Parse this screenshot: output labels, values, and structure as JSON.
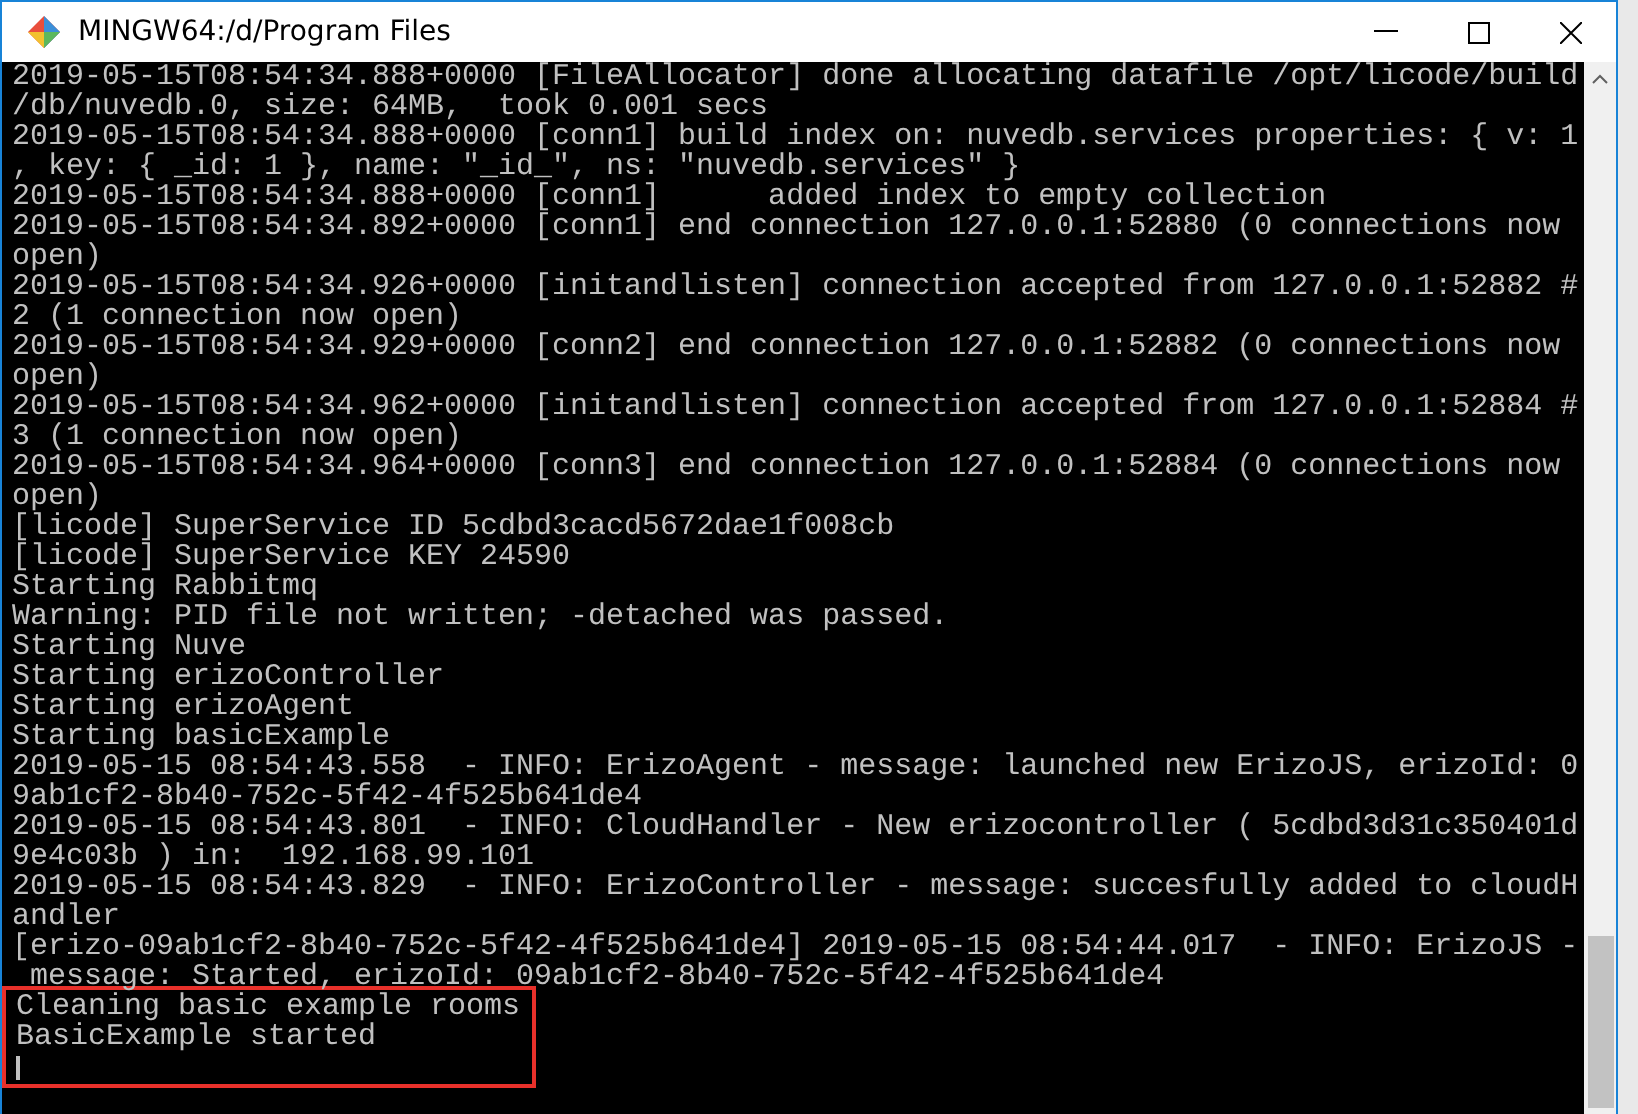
{
  "window": {
    "title": "MINGW64:/d/Program Files"
  },
  "terminal": {
    "lines": [
      "2019-05-15T08:54:34.888+0000 [FileAllocator] done allocating datafile /opt/licode/build",
      "/db/nuvedb.0, size: 64MB,  took 0.001 secs",
      "2019-05-15T08:54:34.888+0000 [conn1] build index on: nuvedb.services properties: { v: 1",
      ", key: { _id: 1 }, name: \"_id_\", ns: \"nuvedb.services\" }",
      "2019-05-15T08:54:34.888+0000 [conn1]      added index to empty collection",
      "2019-05-15T08:54:34.892+0000 [conn1] end connection 127.0.0.1:52880 (0 connections now",
      "open)",
      "2019-05-15T08:54:34.926+0000 [initandlisten] connection accepted from 127.0.0.1:52882 #",
      "2 (1 connection now open)",
      "2019-05-15T08:54:34.929+0000 [conn2] end connection 127.0.0.1:52882 (0 connections now",
      "open)",
      "2019-05-15T08:54:34.962+0000 [initandlisten] connection accepted from 127.0.0.1:52884 #",
      "3 (1 connection now open)",
      "2019-05-15T08:54:34.964+0000 [conn3] end connection 127.0.0.1:52884 (0 connections now",
      "open)",
      "[licode] SuperService ID 5cdbd3cacd5672dae1f008cb",
      "[licode] SuperService KEY 24590",
      "Starting Rabbitmq",
      "Warning: PID file not written; -detached was passed.",
      "Starting Nuve",
      "Starting erizoController",
      "Starting erizoAgent",
      "Starting basicExample",
      "2019-05-15 08:54:43.558  - INFO: ErizoAgent - message: launched new ErizoJS, erizoId: 0",
      "9ab1cf2-8b40-752c-5f42-4f525b641de4",
      "2019-05-15 08:54:43.801  - INFO: CloudHandler - New erizocontroller ( 5cdbd3d31c350401d",
      "9e4c03b ) in:  192.168.99.101",
      "2019-05-15 08:54:43.829  - INFO: ErizoController - message: succesfully added to cloudH",
      "andler",
      "[erizo-09ab1cf2-8b40-752c-5f42-4f525b641de4] 2019-05-15 08:54:44.017  - INFO: ErizoJS -",
      " message: Started, erizoId: 09ab1cf2-8b40-752c-5f42-4f525b641de4"
    ],
    "highlighted_lines": [
      "Cleaning basic example rooms",
      "BasicExample started"
    ]
  }
}
